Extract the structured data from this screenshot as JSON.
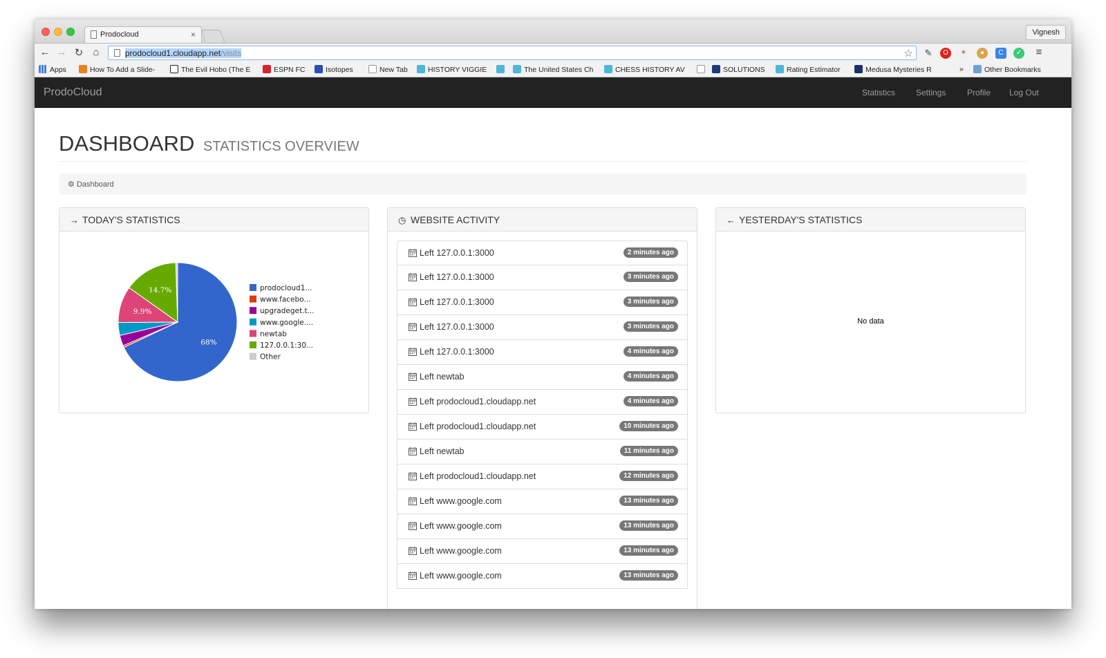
{
  "browser": {
    "tab_title": "Prodocloud",
    "profile_name": "Vignesh",
    "url_host": "prodocloud1.cloudapp.net",
    "url_path": "/visits",
    "bookmarks": [
      {
        "label": "Apps",
        "color": "#4a7ed9"
      },
      {
        "label": "How To Add a Slide-",
        "color": "#e8821e"
      },
      {
        "label": "The Evil Hobo (The E",
        "color": "#222222"
      },
      {
        "label": "ESPN FC",
        "color": "#d8232a"
      },
      {
        "label": "Isotopes",
        "color": "#2a4fb5"
      },
      {
        "label": "New Tab",
        "color": "#ffffff"
      },
      {
        "label": "HISTORY VIGGIE",
        "color": "#4fb6d8"
      },
      {
        "label": "The United States Ch",
        "color": "#4fb6d8"
      },
      {
        "label": "CHESS HISTORY AV",
        "color": "#4fb6d8"
      },
      {
        "label": "SOLUTIONS",
        "color": "#1f3c78"
      },
      {
        "label": "Rating Estimator",
        "color": "#4fb6d8"
      },
      {
        "label": "Medusa Mysteries R",
        "color": "#1d2f6b"
      },
      {
        "label": "»",
        "color": ""
      },
      {
        "label": "Other Bookmarks",
        "color": "#6f9fd8"
      }
    ]
  },
  "navbar": {
    "brand": "ProdoCloud",
    "links": [
      "Statistics",
      "Settings",
      "Profile",
      "Log Out"
    ]
  },
  "header": {
    "title": "DASHBOARD",
    "subtitle": "STATISTICS OVERVIEW"
  },
  "breadcrumb": {
    "label": "Dashboard",
    "icon": "dashboard-icon"
  },
  "panels": {
    "today": {
      "title": "TODAY'S STATISTICS",
      "icon": "arrow-right-icon"
    },
    "activity": {
      "title": "WEBSITE ACTIVITY",
      "icon": "clock-icon"
    },
    "yesterday": {
      "title": "YESTERDAY'S STATISTICS",
      "icon": "arrow-left-icon",
      "empty_text": "No data"
    }
  },
  "chart_data": {
    "type": "pie",
    "categories": [
      "prodocloud1...",
      "www.facebo...",
      "upgradeget.t...",
      "www.google....",
      "newtab",
      "127.0.0.1:30...",
      "Other"
    ],
    "values": [
      68,
      0.5,
      2.9,
      3.5,
      9.9,
      14.7,
      0.5
    ],
    "data_labels": [
      "68%",
      "",
      "",
      "",
      "9.9%",
      "14.7%",
      ""
    ],
    "colors": [
      "#3366cc",
      "#dc3912",
      "#990099",
      "#0099c6",
      "#dd4477",
      "#66aa00",
      "#cccccc"
    ],
    "legend": "right"
  },
  "activity": [
    {
      "text": "Left 127.0.0.1:3000",
      "time": "2 minutes ago"
    },
    {
      "text": "Left 127.0.0.1:3000",
      "time": "3 minutes ago"
    },
    {
      "text": "Left 127.0.0.1:3000",
      "time": "3 minutes ago"
    },
    {
      "text": "Left 127.0.0.1:3000",
      "time": "3 minutes ago"
    },
    {
      "text": "Left 127.0.0.1:3000",
      "time": "4 minutes ago"
    },
    {
      "text": "Left newtab",
      "time": "4 minutes ago"
    },
    {
      "text": "Left prodocloud1.cloudapp.net",
      "time": "4 minutes ago"
    },
    {
      "text": "Left prodocloud1.cloudapp.net",
      "time": "10 minutes ago"
    },
    {
      "text": "Left newtab",
      "time": "11 minutes ago"
    },
    {
      "text": "Left prodocloud1.cloudapp.net",
      "time": "12 minutes ago"
    },
    {
      "text": "Left www.google.com",
      "time": "13 minutes ago"
    },
    {
      "text": "Left www.google.com",
      "time": "13 minutes ago"
    },
    {
      "text": "Left www.google.com",
      "time": "13 minutes ago"
    },
    {
      "text": "Left www.google.com",
      "time": "13 minutes ago"
    }
  ]
}
